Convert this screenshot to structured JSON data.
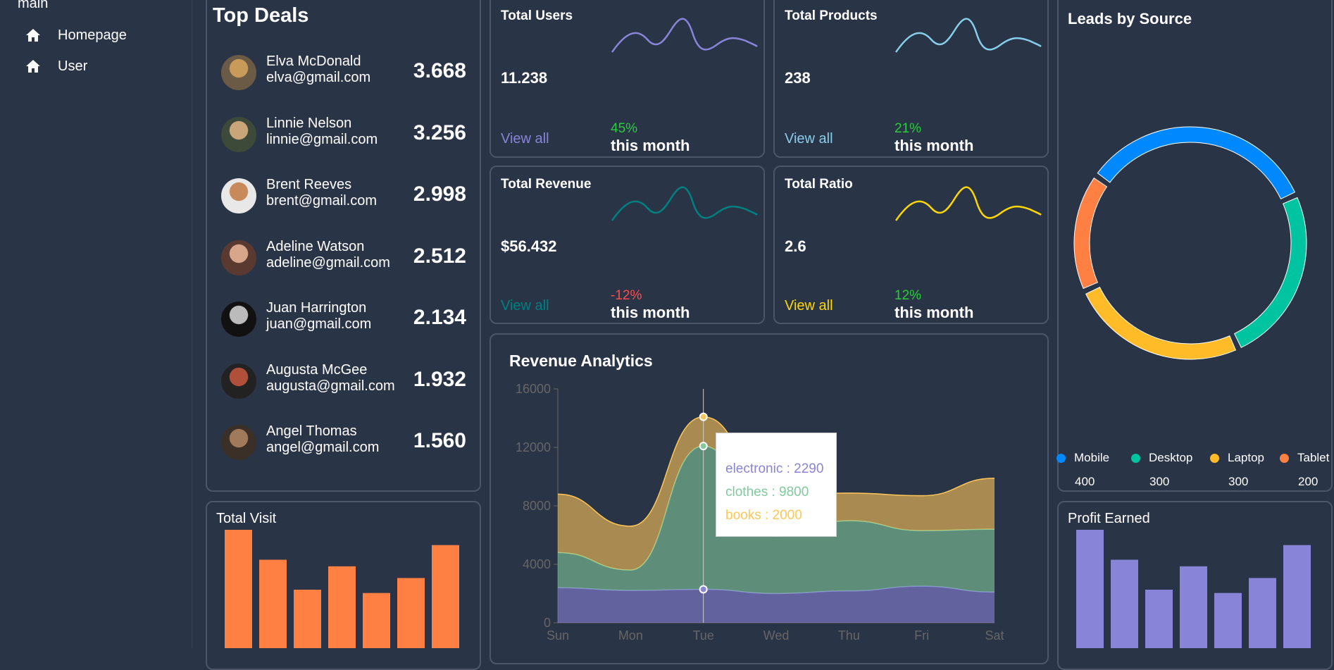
{
  "sidebar": {
    "section": "main",
    "items": [
      {
        "label": "Homepage",
        "icon": "home-icon"
      },
      {
        "label": "User",
        "icon": "home-icon"
      }
    ]
  },
  "top_deals": {
    "title": "Top Deals",
    "deals": [
      {
        "name": "Elva McDonald",
        "email": "elva@gmail.com",
        "amount": "3.668"
      },
      {
        "name": "Linnie Nelson",
        "email": "linnie@gmail.com",
        "amount": "3.256"
      },
      {
        "name": "Brent Reeves",
        "email": "brent@gmail.com",
        "amount": "2.998"
      },
      {
        "name": "Adeline Watson",
        "email": "adeline@gmail.com",
        "amount": "2.512"
      },
      {
        "name": "Juan Harrington",
        "email": "juan@gmail.com",
        "amount": "2.134"
      },
      {
        "name": "Augusta McGee",
        "email": "augusta@gmail.com",
        "amount": "1.932"
      },
      {
        "name": "Angel Thomas",
        "email": "angel@gmail.com",
        "amount": "1.560"
      }
    ]
  },
  "stats": [
    {
      "title": "Total Users",
      "value": "11.238",
      "view": "View all",
      "percent": "45%",
      "period": "this month",
      "color": "#8884d8",
      "pct_color": "#29cc3a"
    },
    {
      "title": "Total Products",
      "value": "238",
      "view": "View all",
      "percent": "21%",
      "period": "this month",
      "color": "#87ceeb",
      "pct_color": "#29cc3a"
    },
    {
      "title": "Total Revenue",
      "value": "$56.432",
      "view": "View all",
      "percent": "-12%",
      "period": "this month",
      "color": "#008080",
      "pct_color": "#ff4d4d"
    },
    {
      "title": "Total Ratio",
      "value": "2.6",
      "view": "View all",
      "percent": "12%",
      "period": "this month",
      "color": "#ffd700",
      "pct_color": "#29cc3a"
    }
  ],
  "leads": {
    "title": "Leads by Source",
    "items": [
      {
        "name": "Mobile",
        "value": "400",
        "color": "#0088fe"
      },
      {
        "name": "Desktop",
        "value": "300",
        "color": "#00c49f"
      },
      {
        "name": "Laptop",
        "value": "300",
        "color": "#ffbb28"
      },
      {
        "name": "Tablet",
        "value": "200",
        "color": "#ff8042"
      }
    ]
  },
  "total_visit": {
    "title": "Total Visit",
    "color": "#ff8042"
  },
  "profit_earned": {
    "title": "Profit Earned",
    "color": "#8884d8"
  },
  "revenue": {
    "title": "Revenue Analytics",
    "tooltip": [
      "electronic : 2290",
      "clothes : 9800",
      "books : 2000"
    ]
  },
  "chart_data": [
    {
      "type": "area",
      "title": "Revenue Analytics",
      "categories": [
        "Sun",
        "Mon",
        "Tue",
        "Wed",
        "Thu",
        "Fri",
        "Sat"
      ],
      "ylim": [
        0,
        16000
      ],
      "yticks": [
        "0",
        "4000",
        "8000",
        "12000",
        "16000"
      ],
      "stacked": true,
      "series": [
        {
          "name": "electronic",
          "values": [
            2400,
            2210,
            2290,
            2000,
            2181,
            2500,
            2100
          ],
          "color": "#8884d8"
        },
        {
          "name": "clothes",
          "values": [
            2400,
            1398,
            9800,
            3908,
            4800,
            3800,
            4300
          ],
          "color": "#82ca9d"
        },
        {
          "name": "books",
          "values": [
            4000,
            3000,
            2000,
            2780,
            1890,
            2390,
            3490
          ],
          "color": "#ffc658"
        }
      ]
    },
    {
      "type": "pie",
      "title": "Leads by Source",
      "labels": [
        "Mobile",
        "Desktop",
        "Laptop",
        "Tablet"
      ],
      "values": [
        400,
        300,
        300,
        200
      ]
    },
    {
      "type": "bar",
      "title": "Total Visit",
      "values": [
        4000,
        3000,
        2000,
        2780,
        1890,
        2390,
        3490
      ]
    },
    {
      "type": "bar",
      "title": "Profit Earned",
      "values": [
        4000,
        3000,
        2000,
        2780,
        1890,
        2390,
        3490
      ]
    }
  ]
}
